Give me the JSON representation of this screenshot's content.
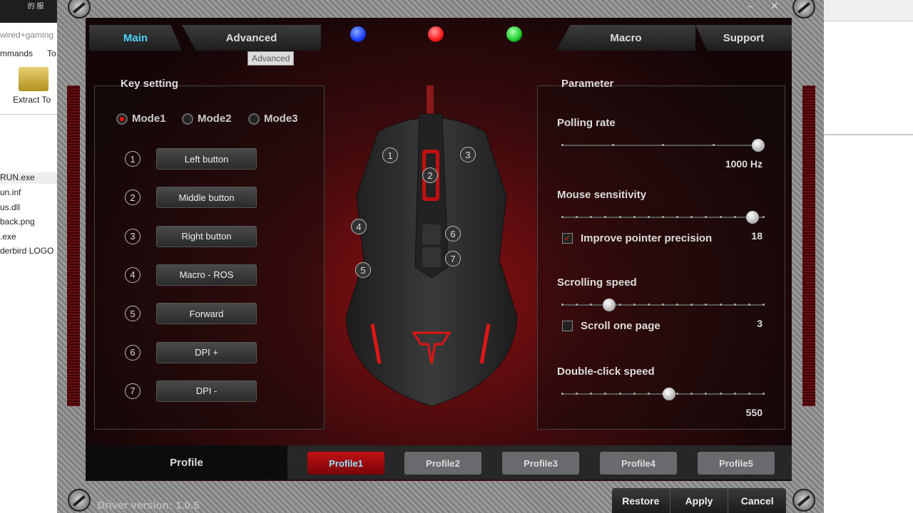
{
  "background_explorer": {
    "title_chars": "的 服",
    "address": "wired+gaming",
    "menu": [
      "mmands",
      "To"
    ],
    "extract_label": "Extract To",
    "files": [
      "RUN.exe",
      "un.inf",
      "us.dll",
      "back.png",
      ".exe",
      "derbird LOGO"
    ]
  },
  "window": {
    "minimize": "–",
    "close": "✕"
  },
  "tabs": [
    {
      "label": "Main",
      "active": true
    },
    {
      "label": "Advanced"
    },
    {
      "label": "Macro"
    },
    {
      "label": "Support"
    }
  ],
  "tooltip": "Advanced",
  "leds": [
    "#1a3cff",
    "#ff1a1a",
    "#1acc2a"
  ],
  "key_setting": {
    "title": "Key setting",
    "modes": [
      {
        "label": "Mode1",
        "selected": true
      },
      {
        "label": "Mode2"
      },
      {
        "label": "Mode3"
      }
    ],
    "keys": [
      {
        "num": "1",
        "label": "Left button"
      },
      {
        "num": "2",
        "label": "Middle button"
      },
      {
        "num": "3",
        "label": "Right button"
      },
      {
        "num": "4",
        "label": "Macro - ROS"
      },
      {
        "num": "5",
        "label": "Forward"
      },
      {
        "num": "6",
        "label": "DPI +"
      },
      {
        "num": "7",
        "label": "DPI -"
      }
    ]
  },
  "mouse_labels": [
    "1",
    "2",
    "3",
    "4",
    "5",
    "6",
    "7"
  ],
  "parameter": {
    "title": "Parameter",
    "polling": {
      "label": "Polling rate",
      "value": "1000 Hz",
      "level": 1.0
    },
    "sensitivity": {
      "label": "Mouse sensitivity",
      "value": "18",
      "level": 0.97,
      "checkbox": "Improve pointer precision",
      "checked": true
    },
    "scrolling": {
      "label": "Scrolling speed",
      "value": "3",
      "level": 0.23,
      "checkbox": "Scroll one page",
      "checked": false
    },
    "doubleclick": {
      "label": "Double-click speed",
      "value": "550",
      "level": 0.54
    }
  },
  "profile": {
    "label": "Profile",
    "items": [
      "Profile1",
      "Profile2",
      "Profile3",
      "Profile4",
      "Profile5"
    ],
    "active": 0
  },
  "driver_version": "Driver version:  1.0.5",
  "buttons": {
    "restore": "Restore",
    "apply": "Apply",
    "cancel": "Cancel"
  },
  "accent": "#4cd3ff"
}
